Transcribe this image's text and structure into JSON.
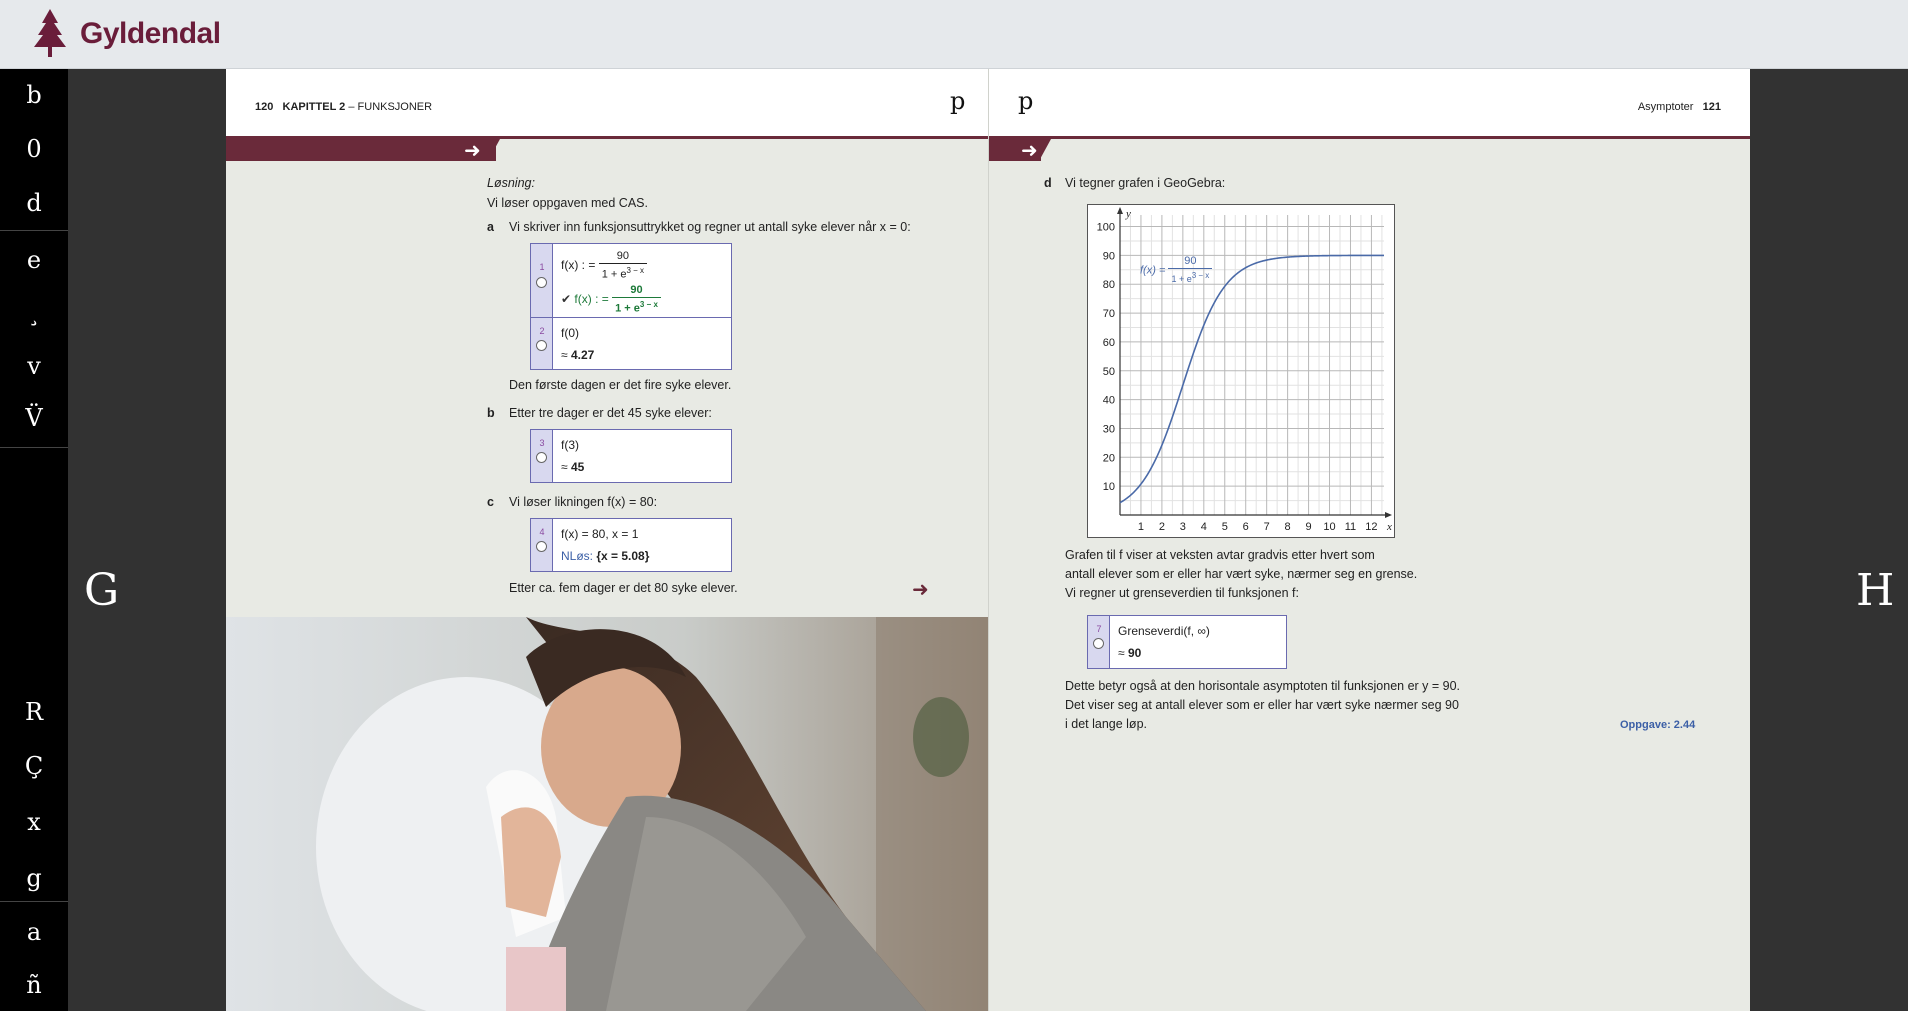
{
  "header": {
    "brand": "Gyldendal"
  },
  "sidebar": {
    "buttons": [
      "b",
      "0",
      "d",
      "e",
      "¸",
      "v",
      "V̈",
      "R",
      "Ç",
      "x",
      "g",
      "a",
      "ñ"
    ]
  },
  "nav": {
    "prev": "G",
    "next": "H"
  },
  "left_page": {
    "page_number": "120",
    "chapter": "KAPITTEL 2",
    "chapter_sep": " – ",
    "chapter_title": "FUNKSJONER",
    "corner_glyph": "p",
    "losning": "Løsning:",
    "intro": "Vi løser oppgaven med CAS.",
    "a_label": "a",
    "a_text": "Vi skriver inn funksjonsuttrykket og regner ut antall syke elever når x = 0:",
    "cas1_num": "1",
    "cas1_in_lhs": "f(x) : =",
    "cas1_frac_num": "90",
    "cas1_frac_den": "1 + e",
    "cas1_frac_exp": "3 − x",
    "cas1_check": "✔",
    "cas1_out_lhs": "f(x) : =",
    "cas1_out_num": "90",
    "cas1_out_den": "1 + e",
    "cas1_out_exp": "3 − x",
    "cas2_num": "2",
    "cas2_in": "f(0)",
    "cas2_approx": "≈",
    "cas2_out": "4.27",
    "a_after": "Den første dagen er det fire syke elever.",
    "b_label": "b",
    "b_text": "Etter tre dager er det 45 syke elever:",
    "cas3_num": "3",
    "cas3_in": "f(3)",
    "cas3_approx": "≈",
    "cas3_out": "45",
    "c_label": "c",
    "c_text": "Vi løser likningen f(x) = 80:",
    "cas4_num": "4",
    "cas4_in": "f(x) = 80, x = 1",
    "cas4_out_label": "NLøs:",
    "cas4_out": "{x = 5.08}",
    "c_after": "Etter ca. fem dager er det 80 syke elever."
  },
  "right_page": {
    "page_number": "121",
    "section": "Asymptoter",
    "corner_glyph": "p",
    "d_label": "d",
    "d_text": "Vi tegner grafen i GeoGebra:",
    "graph_func": "f(x) =",
    "graph_num": "90",
    "graph_den": "1 + e",
    "graph_exp": "3 − x",
    "p1": "Grafen til f viser at veksten avtar gradvis etter hvert som",
    "p2": "antall elever som er eller har vært syke, nærmer seg en grense.",
    "p3": "Vi regner ut grenseverdien til funksjonen f:",
    "cas7_num": "7",
    "cas7_in": "Grenseverdi(f, ∞)",
    "cas7_approx": "≈",
    "cas7_out": "90",
    "p4": "Dette betyr også at den horisontale asymptoten til funksjonen er y = 90.",
    "p5": "Det viser seg at antall elever som er eller har vært syke nærmer seg 90",
    "p6": "i det lange løp.",
    "oppgave": "Oppgave: 2.44"
  },
  "chart_data": {
    "type": "line",
    "x_ticks": [
      "1",
      "2",
      "3",
      "4",
      "5",
      "6",
      "7",
      "8",
      "9",
      "10",
      "11",
      "12"
    ],
    "y_ticks": [
      "10",
      "20",
      "30",
      "40",
      "50",
      "60",
      "70",
      "80",
      "90",
      "100"
    ],
    "xlabel": "x",
    "ylabel": "y",
    "xlim": [
      0,
      12.6
    ],
    "ylim": [
      0,
      104
    ],
    "function": "90/(1+e^(3-x))",
    "x": [
      0,
      1,
      2,
      3,
      4,
      5,
      6,
      7,
      8,
      9,
      10,
      11,
      12.6
    ],
    "y": [
      4.27,
      10.7,
      24.2,
      45,
      65.8,
      79.3,
      85.7,
      88.4,
      89.4,
      89.8,
      89.9,
      90.0,
      90.0
    ],
    "color": "#4a6aa8",
    "grid": true
  },
  "colors": {
    "brand": "#6a1d3a",
    "band": "#6a2a3a",
    "cas_border": "#6a6ab0",
    "link": "#3b5fa6"
  }
}
